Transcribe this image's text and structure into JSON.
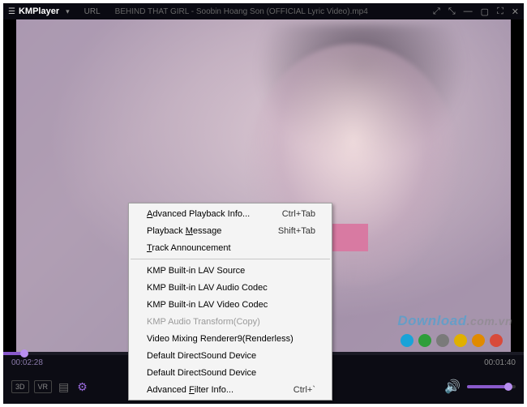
{
  "titlebar": {
    "app_name": "KMPlayer",
    "url_label": "URL",
    "file_title": "BEHIND THAT GIRL - Soobin Hoang Son (OFFICIAL Lyric Video).mp4"
  },
  "watermark": {
    "main": "Download",
    "suffix": ".com.vn"
  },
  "dots": {
    "colors": [
      "#1aa3d8",
      "#2e9e3a",
      "#7a7a7a",
      "#e0b000",
      "#e08a00",
      "#d84a3a"
    ]
  },
  "time": {
    "elapsed": "00:02:28",
    "total": "00:01:40"
  },
  "controls": {
    "badge_3d": "3D",
    "badge_vr": "VR"
  },
  "context_menu": {
    "items": [
      {
        "label": "Advanced Playback Info...",
        "shortcut": "Ctrl+Tab",
        "underline": 0
      },
      {
        "label": "Playback Message",
        "shortcut": "Shift+Tab",
        "underline": 9
      },
      {
        "label": "Track Announcement",
        "shortcut": "",
        "underline": 0
      }
    ],
    "items2": [
      {
        "label": "KMP Built-in LAV Source",
        "shortcut": ""
      },
      {
        "label": "KMP Built-in LAV Audio Codec",
        "shortcut": ""
      },
      {
        "label": "KMP Built-in LAV Video Codec",
        "shortcut": ""
      },
      {
        "label": "KMP Audio Transform(Copy)",
        "shortcut": "",
        "disabled": true
      },
      {
        "label": "Video Mixing Renderer9(Renderless)",
        "shortcut": ""
      },
      {
        "label": "Default DirectSound Device",
        "shortcut": ""
      },
      {
        "label": "Default DirectSound Device",
        "shortcut": ""
      },
      {
        "label": "Advanced Filter Info...",
        "shortcut": "Ctrl+`",
        "underline": 9
      }
    ]
  }
}
